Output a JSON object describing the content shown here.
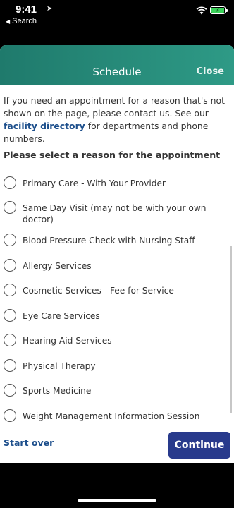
{
  "status_bar": {
    "time": "9:41",
    "back_label": "Search",
    "battery_level": 1.0
  },
  "header": {
    "title": "Schedule",
    "close_label": "Close"
  },
  "intro": {
    "text_before": "If you need an appointment for a reason that's not shown on the page, please contact us. See our ",
    "link_text": "facility directory",
    "text_after": " for departments and phone numbers."
  },
  "prompt": "Please select a reason for the appointment",
  "options": [
    {
      "label": "Primary Care - With Your Provider"
    },
    {
      "label": "Same Day Visit (may not be with your own doctor)"
    },
    {
      "label": "Blood Pressure Check with Nursing Staff"
    },
    {
      "label": "Allergy Services"
    },
    {
      "label": "Cosmetic Services - Fee for Service"
    },
    {
      "label": "Eye Care Services"
    },
    {
      "label": "Hearing Aid Services"
    },
    {
      "label": "Physical Therapy"
    },
    {
      "label": "Sports Medicine"
    },
    {
      "label": "Weight Management Information Session"
    }
  ],
  "footer": {
    "start_over_label": "Start over",
    "continue_label": "Continue"
  },
  "colors": {
    "header_start": "#1f7a6c",
    "header_end": "#2e9a86",
    "link": "#1d4f8c",
    "continue_bg": "#283a8c"
  }
}
